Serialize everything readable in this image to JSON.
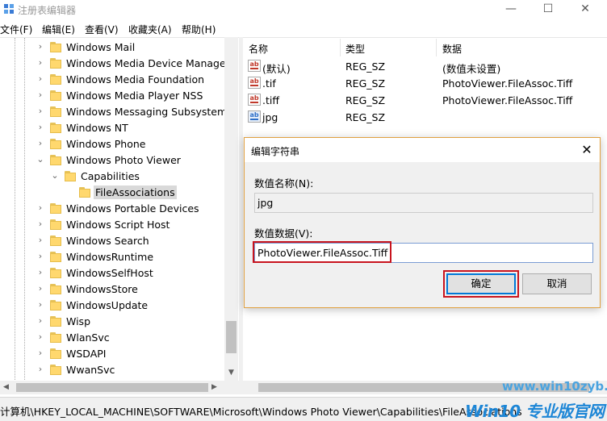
{
  "window": {
    "title": "注册表编辑器",
    "min_glyph": "—",
    "max_glyph": "☐",
    "close_glyph": "✕"
  },
  "menu": [
    "文件(F)",
    "编辑(E)",
    "查看(V)",
    "收藏夹(A)",
    "帮助(H)"
  ],
  "tree": {
    "items": [
      {
        "label": "Windows Mail",
        "expanded": false,
        "level": 0
      },
      {
        "label": "Windows Media Device Manager",
        "expanded": false,
        "level": 0
      },
      {
        "label": "Windows Media Foundation",
        "expanded": false,
        "level": 0
      },
      {
        "label": "Windows Media Player NSS",
        "expanded": false,
        "level": 0
      },
      {
        "label": "Windows Messaging Subsystem",
        "expanded": false,
        "level": 0
      },
      {
        "label": "Windows NT",
        "expanded": false,
        "level": 0
      },
      {
        "label": "Windows Phone",
        "expanded": false,
        "level": 0
      },
      {
        "label": "Windows Photo Viewer",
        "expanded": true,
        "level": 0
      },
      {
        "label": "Capabilities",
        "expanded": true,
        "level": 1
      },
      {
        "label": "FileAssociations",
        "expanded": null,
        "level": 2,
        "selected": true
      },
      {
        "label": "Windows Portable Devices",
        "expanded": false,
        "level": 0
      },
      {
        "label": "Windows Script Host",
        "expanded": false,
        "level": 0
      },
      {
        "label": "Windows Search",
        "expanded": false,
        "level": 0
      },
      {
        "label": "WindowsRuntime",
        "expanded": false,
        "level": 0
      },
      {
        "label": "WindowsSelfHost",
        "expanded": false,
        "level": 0
      },
      {
        "label": "WindowsStore",
        "expanded": false,
        "level": 0
      },
      {
        "label": "WindowsUpdate",
        "expanded": false,
        "level": 0
      },
      {
        "label": "Wisp",
        "expanded": false,
        "level": 0
      },
      {
        "label": "WlanSvc",
        "expanded": false,
        "level": 0
      },
      {
        "label": "WSDAPI",
        "expanded": false,
        "level": 0
      },
      {
        "label": "WwanSvc",
        "expanded": false,
        "level": 0
      }
    ]
  },
  "list": {
    "headers": {
      "name": "名称",
      "type": "类型",
      "data": "数据"
    },
    "rows": [
      {
        "name": "(默认)",
        "type": "REG_SZ",
        "data": "(数值未设置)",
        "icon": "string-value-icon"
      },
      {
        "name": ".tif",
        "type": "REG_SZ",
        "data": "PhotoViewer.FileAssoc.Tiff",
        "icon": "string-value-icon"
      },
      {
        "name": ".tiff",
        "type": "REG_SZ",
        "data": "PhotoViewer.FileAssoc.Tiff",
        "icon": "string-value-icon"
      },
      {
        "name": "jpg",
        "type": "REG_SZ",
        "data": "",
        "icon": "string-value-icon"
      }
    ]
  },
  "status": {
    "path": "计算机\\HKEY_LOCAL_MACHINE\\SOFTWARE\\Microsoft\\Windows Photo Viewer\\Capabilities\\FileAssociations"
  },
  "watermark": {
    "line1": "www.win10zyb.com",
    "line2": "Win10 专业版官网"
  },
  "dialog": {
    "title": "编辑字符串",
    "name_label": "数值名称(N):",
    "name_value": "jpg",
    "data_label": "数值数据(V):",
    "data_value": "PhotoViewer.FileAssoc.Tiff",
    "ok_label": "确定",
    "cancel_label": "取消",
    "close_glyph": "✕"
  }
}
